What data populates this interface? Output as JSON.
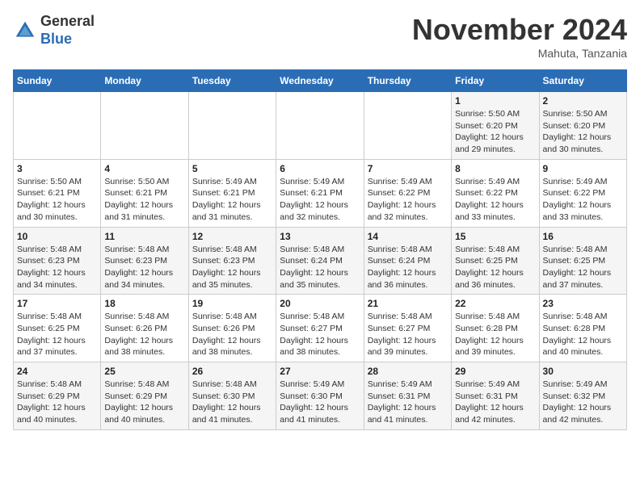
{
  "header": {
    "logo_line1": "General",
    "logo_line2": "Blue",
    "month": "November 2024",
    "location": "Mahuta, Tanzania"
  },
  "days_of_week": [
    "Sunday",
    "Monday",
    "Tuesday",
    "Wednesday",
    "Thursday",
    "Friday",
    "Saturday"
  ],
  "weeks": [
    [
      {
        "day": "",
        "info": ""
      },
      {
        "day": "",
        "info": ""
      },
      {
        "day": "",
        "info": ""
      },
      {
        "day": "",
        "info": ""
      },
      {
        "day": "",
        "info": ""
      },
      {
        "day": "1",
        "info": "Sunrise: 5:50 AM\nSunset: 6:20 PM\nDaylight: 12 hours and 29 minutes."
      },
      {
        "day": "2",
        "info": "Sunrise: 5:50 AM\nSunset: 6:20 PM\nDaylight: 12 hours and 30 minutes."
      }
    ],
    [
      {
        "day": "3",
        "info": "Sunrise: 5:50 AM\nSunset: 6:21 PM\nDaylight: 12 hours and 30 minutes."
      },
      {
        "day": "4",
        "info": "Sunrise: 5:50 AM\nSunset: 6:21 PM\nDaylight: 12 hours and 31 minutes."
      },
      {
        "day": "5",
        "info": "Sunrise: 5:49 AM\nSunset: 6:21 PM\nDaylight: 12 hours and 31 minutes."
      },
      {
        "day": "6",
        "info": "Sunrise: 5:49 AM\nSunset: 6:21 PM\nDaylight: 12 hours and 32 minutes."
      },
      {
        "day": "7",
        "info": "Sunrise: 5:49 AM\nSunset: 6:22 PM\nDaylight: 12 hours and 32 minutes."
      },
      {
        "day": "8",
        "info": "Sunrise: 5:49 AM\nSunset: 6:22 PM\nDaylight: 12 hours and 33 minutes."
      },
      {
        "day": "9",
        "info": "Sunrise: 5:49 AM\nSunset: 6:22 PM\nDaylight: 12 hours and 33 minutes."
      }
    ],
    [
      {
        "day": "10",
        "info": "Sunrise: 5:48 AM\nSunset: 6:23 PM\nDaylight: 12 hours and 34 minutes."
      },
      {
        "day": "11",
        "info": "Sunrise: 5:48 AM\nSunset: 6:23 PM\nDaylight: 12 hours and 34 minutes."
      },
      {
        "day": "12",
        "info": "Sunrise: 5:48 AM\nSunset: 6:23 PM\nDaylight: 12 hours and 35 minutes."
      },
      {
        "day": "13",
        "info": "Sunrise: 5:48 AM\nSunset: 6:24 PM\nDaylight: 12 hours and 35 minutes."
      },
      {
        "day": "14",
        "info": "Sunrise: 5:48 AM\nSunset: 6:24 PM\nDaylight: 12 hours and 36 minutes."
      },
      {
        "day": "15",
        "info": "Sunrise: 5:48 AM\nSunset: 6:25 PM\nDaylight: 12 hours and 36 minutes."
      },
      {
        "day": "16",
        "info": "Sunrise: 5:48 AM\nSunset: 6:25 PM\nDaylight: 12 hours and 37 minutes."
      }
    ],
    [
      {
        "day": "17",
        "info": "Sunrise: 5:48 AM\nSunset: 6:25 PM\nDaylight: 12 hours and 37 minutes."
      },
      {
        "day": "18",
        "info": "Sunrise: 5:48 AM\nSunset: 6:26 PM\nDaylight: 12 hours and 38 minutes."
      },
      {
        "day": "19",
        "info": "Sunrise: 5:48 AM\nSunset: 6:26 PM\nDaylight: 12 hours and 38 minutes."
      },
      {
        "day": "20",
        "info": "Sunrise: 5:48 AM\nSunset: 6:27 PM\nDaylight: 12 hours and 38 minutes."
      },
      {
        "day": "21",
        "info": "Sunrise: 5:48 AM\nSunset: 6:27 PM\nDaylight: 12 hours and 39 minutes."
      },
      {
        "day": "22",
        "info": "Sunrise: 5:48 AM\nSunset: 6:28 PM\nDaylight: 12 hours and 39 minutes."
      },
      {
        "day": "23",
        "info": "Sunrise: 5:48 AM\nSunset: 6:28 PM\nDaylight: 12 hours and 40 minutes."
      }
    ],
    [
      {
        "day": "24",
        "info": "Sunrise: 5:48 AM\nSunset: 6:29 PM\nDaylight: 12 hours and 40 minutes."
      },
      {
        "day": "25",
        "info": "Sunrise: 5:48 AM\nSunset: 6:29 PM\nDaylight: 12 hours and 40 minutes."
      },
      {
        "day": "26",
        "info": "Sunrise: 5:48 AM\nSunset: 6:30 PM\nDaylight: 12 hours and 41 minutes."
      },
      {
        "day": "27",
        "info": "Sunrise: 5:49 AM\nSunset: 6:30 PM\nDaylight: 12 hours and 41 minutes."
      },
      {
        "day": "28",
        "info": "Sunrise: 5:49 AM\nSunset: 6:31 PM\nDaylight: 12 hours and 41 minutes."
      },
      {
        "day": "29",
        "info": "Sunrise: 5:49 AM\nSunset: 6:31 PM\nDaylight: 12 hours and 42 minutes."
      },
      {
        "day": "30",
        "info": "Sunrise: 5:49 AM\nSunset: 6:32 PM\nDaylight: 12 hours and 42 minutes."
      }
    ]
  ]
}
